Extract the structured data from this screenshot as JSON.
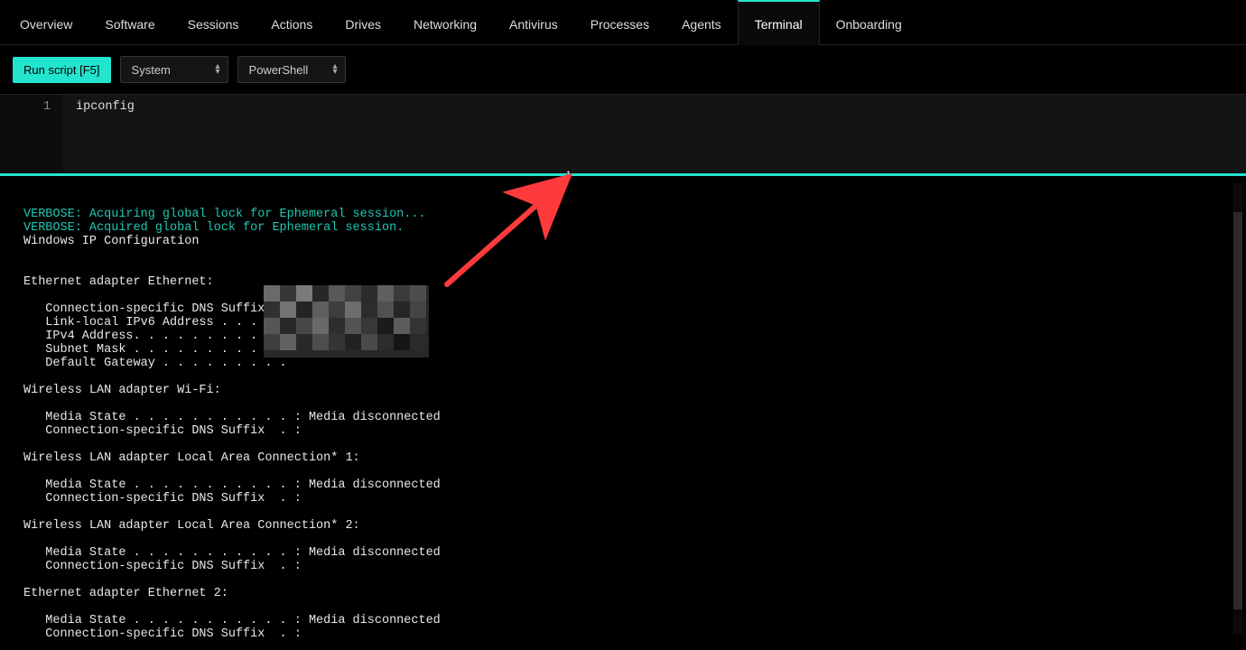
{
  "tabs": [
    {
      "label": "Overview"
    },
    {
      "label": "Software"
    },
    {
      "label": "Sessions"
    },
    {
      "label": "Actions"
    },
    {
      "label": "Drives"
    },
    {
      "label": "Networking"
    },
    {
      "label": "Antivirus"
    },
    {
      "label": "Processes"
    },
    {
      "label": "Agents"
    },
    {
      "label": "Terminal"
    },
    {
      "label": "Onboarding"
    }
  ],
  "active_tab_index": 9,
  "toolbar": {
    "run_label": "Run script [F5]",
    "context_value": "System",
    "shell_value": "PowerShell"
  },
  "editor": {
    "line_number": "1",
    "code": "ipconfig"
  },
  "output": {
    "verbose1": "VERBOSE: Acquiring global lock for Ephemeral session...",
    "verbose2": "VERBOSE: Acquired global lock for Ephemeral session.",
    "body": "\nWindows IP Configuration\n\n\nEthernet adapter Ethernet:\n\n   Connection-specific DNS Suffix  .\n   Link-local IPv6 Address . . . . .\n   IPv4 Address. . . . . . . . . . .\n   Subnet Mask . . . . . . . . . . .\n   Default Gateway . . . . . . . . .\n\nWireless LAN adapter Wi-Fi:\n\n   Media State . . . . . . . . . . . : Media disconnected\n   Connection-specific DNS Suffix  . :\n\nWireless LAN adapter Local Area Connection* 1:\n\n   Media State . . . . . . . . . . . : Media disconnected\n   Connection-specific DNS Suffix  . :\n\nWireless LAN adapter Local Area Connection* 2:\n\n   Media State . . . . . . . . . . . : Media disconnected\n   Connection-specific DNS Suffix  . :\n\nEthernet adapter Ethernet 2:\n\n   Media State . . . . . . . . . . . : Media disconnected\n   Connection-specific DNS Suffix  . :"
  },
  "colors": {
    "accent": "#23e5cf",
    "arrow": "#ff3a3d"
  }
}
